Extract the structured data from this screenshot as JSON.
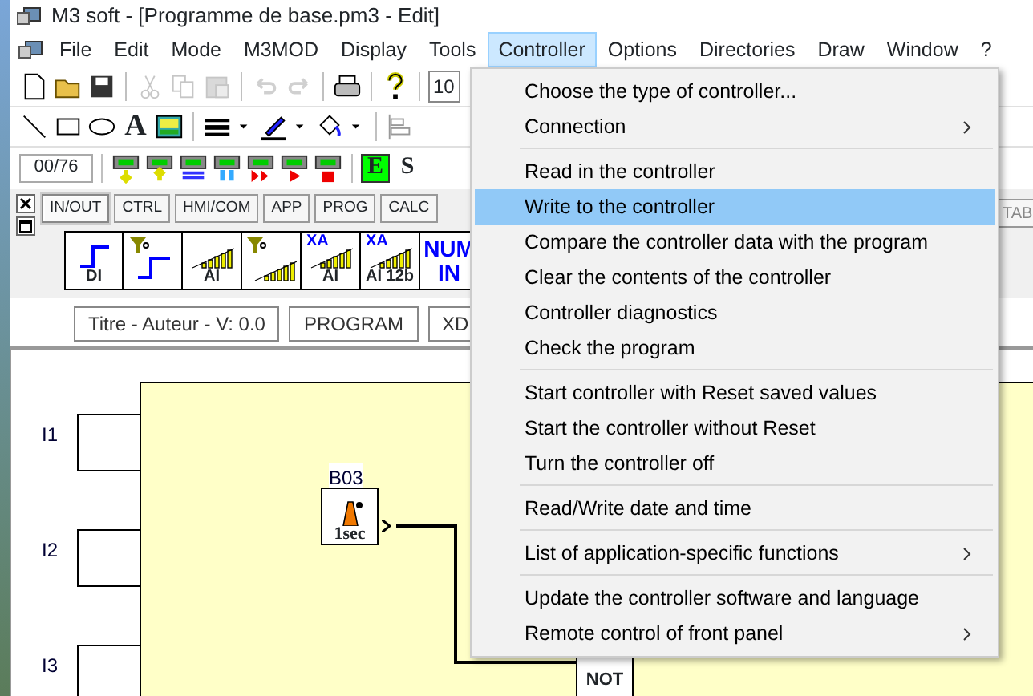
{
  "window": {
    "title": "M3 soft - [Programme de base.pm3 - Edit]"
  },
  "menu_bar": [
    {
      "label": "File",
      "selected": false
    },
    {
      "label": "Edit",
      "selected": false
    },
    {
      "label": "Mode",
      "selected": false
    },
    {
      "label": "M3MOD",
      "selected": false
    },
    {
      "label": "Display",
      "selected": false
    },
    {
      "label": "Tools",
      "selected": false
    },
    {
      "label": "Controller",
      "selected": true
    },
    {
      "label": "Options",
      "selected": false
    },
    {
      "label": "Directories",
      "selected": false
    },
    {
      "label": "Draw",
      "selected": false
    },
    {
      "label": "Window",
      "selected": false
    },
    {
      "label": "?",
      "selected": false
    }
  ],
  "toolbar_1": {
    "buttons": [
      {
        "kind": "new",
        "disabled": false
      },
      {
        "kind": "open",
        "disabled": false
      },
      {
        "kind": "save",
        "disabled": false
      },
      {
        "kind": "separator"
      },
      {
        "kind": "cut",
        "disabled": true
      },
      {
        "kind": "copy",
        "disabled": true
      },
      {
        "kind": "paste",
        "disabled": true
      },
      {
        "kind": "separator"
      },
      {
        "kind": "undo",
        "disabled": true
      },
      {
        "kind": "redo",
        "disabled": true
      },
      {
        "kind": "separator"
      },
      {
        "kind": "print",
        "disabled": false
      },
      {
        "kind": "separator"
      },
      {
        "kind": "help",
        "disabled": false
      }
    ],
    "zoom_field": "10"
  },
  "toolbar_2": {
    "buttons": [
      {
        "kind": "line"
      },
      {
        "kind": "rectangle"
      },
      {
        "kind": "ellipse"
      },
      {
        "kind": "text",
        "glyph": "A"
      },
      {
        "kind": "image"
      },
      {
        "kind": "separator"
      },
      {
        "kind": "line-weight"
      },
      {
        "kind": "caret"
      },
      {
        "kind": "pen"
      },
      {
        "kind": "caret"
      },
      {
        "kind": "fill"
      },
      {
        "kind": "caret"
      },
      {
        "kind": "separator"
      },
      {
        "kind": "align"
      }
    ]
  },
  "toolbar_3": {
    "counter": "00/76",
    "buttons": [
      {
        "kind": "down"
      },
      {
        "kind": "up"
      },
      {
        "kind": "swap"
      },
      {
        "kind": "updown"
      },
      {
        "kind": "fast"
      },
      {
        "kind": "play"
      },
      {
        "kind": "stop"
      }
    ],
    "modes": [
      {
        "label": "E",
        "selected": true
      },
      {
        "label": "S",
        "selected": false
      }
    ]
  },
  "palette": {
    "tabs": [
      {
        "label": "IN/OUT",
        "selected": true
      },
      {
        "label": "CTRL",
        "selected": false
      },
      {
        "label": "HMI/COM",
        "selected": false
      },
      {
        "label": "APP",
        "selected": false
      },
      {
        "label": "PROG",
        "selected": false
      },
      {
        "label": "CALC",
        "selected": false
      }
    ],
    "hidden_tab": "TAB",
    "blocks": [
      {
        "kind": "step",
        "label": "DI"
      },
      {
        "kind": "filter-step"
      },
      {
        "kind": "bars",
        "label": "AI"
      },
      {
        "kind": "filter-bars"
      },
      {
        "kind": "xa-bars",
        "prefix": "XA",
        "label": "AI"
      },
      {
        "kind": "xa-bars",
        "prefix": "XA",
        "label": "AI 12b"
      },
      {
        "kind": "numeric",
        "label": "NUM IN"
      }
    ]
  },
  "document_tabs": [
    "Titre - Auteur - V: 0.0",
    "PROGRAM",
    "XD"
  ],
  "diagram": {
    "inputs": [
      "I1",
      "I2",
      "I3"
    ],
    "blocks": [
      {
        "kind": "timer",
        "label": "B03",
        "caption": "1sec"
      },
      {
        "kind": "not",
        "caption": "NOT"
      }
    ]
  },
  "dropdown": {
    "items": [
      {
        "kind": "item",
        "label": "Choose the type of controller...",
        "submenu": false,
        "selected": false
      },
      {
        "kind": "item",
        "label": "Connection",
        "submenu": true,
        "selected": false
      },
      {
        "kind": "separator"
      },
      {
        "kind": "item",
        "label": "Read in the controller",
        "submenu": false,
        "selected": false
      },
      {
        "kind": "item",
        "label": "Write to the controller",
        "submenu": false,
        "selected": true
      },
      {
        "kind": "item",
        "label": "Compare the controller data with the program",
        "submenu": false,
        "selected": false
      },
      {
        "kind": "item",
        "label": "Clear the contents of the controller",
        "submenu": false,
        "selected": false
      },
      {
        "kind": "item",
        "label": "Controller diagnostics",
        "submenu": false,
        "selected": false
      },
      {
        "kind": "item",
        "label": "Check the program",
        "submenu": false,
        "selected": false
      },
      {
        "kind": "separator"
      },
      {
        "kind": "item",
        "label": "Start controller with Reset saved values",
        "submenu": false,
        "selected": false
      },
      {
        "kind": "item",
        "label": "Start the controller without Reset",
        "submenu": false,
        "selected": false
      },
      {
        "kind": "item",
        "label": "Turn the controller off",
        "submenu": false,
        "selected": false
      },
      {
        "kind": "separator"
      },
      {
        "kind": "item",
        "label": "Read/Write date and time",
        "submenu": false,
        "selected": false
      },
      {
        "kind": "separator"
      },
      {
        "kind": "item",
        "label": "List of application-specific functions",
        "submenu": true,
        "selected": false
      },
      {
        "kind": "separator"
      },
      {
        "kind": "item",
        "label": "Update the controller software and language",
        "submenu": false,
        "selected": false
      },
      {
        "kind": "item",
        "label": "Remote control of front panel",
        "submenu": true,
        "selected": false
      }
    ]
  }
}
